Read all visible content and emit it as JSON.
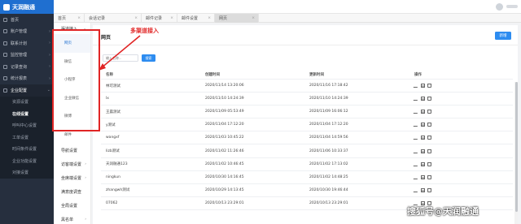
{
  "brand": {
    "name": "天润融通"
  },
  "sidebar": {
    "items": [
      {
        "label": "首页",
        "arrow": ""
      },
      {
        "label": "账户管理",
        "arrow": "›"
      },
      {
        "label": "联系计划",
        "arrow": "›"
      },
      {
        "label": "监控管理",
        "arrow": "›"
      },
      {
        "label": "记录查询",
        "arrow": "›"
      },
      {
        "label": "统计报表",
        "arrow": "›"
      },
      {
        "label": "企业配置",
        "arrow": "⌄"
      }
    ],
    "subitems": [
      {
        "label": "资源设置"
      },
      {
        "label": "在线设置"
      },
      {
        "label": "呼叫中心设置"
      },
      {
        "label": "工单设置"
      },
      {
        "label": "时间条件设置"
      },
      {
        "label": "企业功能设置"
      },
      {
        "label": "对接设置"
      }
    ]
  },
  "tabs": [
    {
      "label": "首页",
      "close": "×"
    },
    {
      "label": "会话记录",
      "close": "×"
    },
    {
      "label": "邮件记录",
      "close": "×"
    },
    {
      "label": "邮件设置",
      "close": "×"
    },
    {
      "label": "网页",
      "close": "×"
    }
  ],
  "submenu": {
    "group_label": "渠道接入",
    "group_arrow": "⌄",
    "children": [
      "网页",
      "微信",
      "小程序",
      "企业微信",
      "微博",
      "邮件"
    ],
    "items": [
      {
        "label": "导航设置",
        "arrow": ""
      },
      {
        "label": "访客端设置",
        "arrow": "›"
      },
      {
        "label": "坐席端设置",
        "arrow": "›"
      },
      {
        "label": "满意度调查",
        "arrow": ""
      },
      {
        "label": "全局设置",
        "arrow": ""
      },
      {
        "label": "黑名单",
        "arrow": "›"
      }
    ]
  },
  "annotation": {
    "text": "多渠道接入",
    "color": "#e02424"
  },
  "main": {
    "title": "网页",
    "add_button": "新增",
    "search_placeholder": "输入名称...",
    "search_button": "搜索",
    "columns": [
      "名称",
      "创建时间",
      "更新时间",
      "操作"
    ],
    "rows": [
      {
        "name": "林可测试",
        "created": "2020/11/14 13:20:06",
        "updated": "2020/11/16 17:18:42"
      },
      {
        "name": "lx",
        "created": "2020/11/10 14:24:39",
        "updated": "2020/11/10 14:24:39"
      },
      {
        "name": "王晨测试",
        "created": "2020/11/09 05:53:49",
        "updated": "2020/11/09 16:06:12"
      },
      {
        "name": "y测试",
        "created": "2020/11/04 17:12:20",
        "updated": "2020/11/04 17:12:20"
      },
      {
        "name": "wangxf",
        "created": "2020/11/03 10:45:22",
        "updated": "2020/11/04 14:59:56"
      },
      {
        "name": "lizb测试",
        "created": "2020/11/02 11:26:46",
        "updated": "2020/11/06 10:33:37"
      },
      {
        "name": "天润融通123",
        "created": "2020/11/02 10:46:45",
        "updated": "2020/11/02 17:13:02"
      },
      {
        "name": "ningkun",
        "created": "2020/10/30 14:16:45",
        "updated": "2020/11/02 14:48:25"
      },
      {
        "name": "zhangwh测试",
        "created": "2020/10/29 14:13:45",
        "updated": "2020/10/30 19:46:44"
      },
      {
        "name": "07062",
        "created": "2020/10/13 23:29:01",
        "updated": "2020/10/13 23:29:01"
      }
    ]
  },
  "watermark": {
    "text": "搜狐号@天润融通"
  },
  "colors": {
    "accent": "#2d8cf0",
    "sidebar_bg": "#262f3e",
    "highlight": "#e02424",
    "brand_bg": "#1f6fd0"
  }
}
